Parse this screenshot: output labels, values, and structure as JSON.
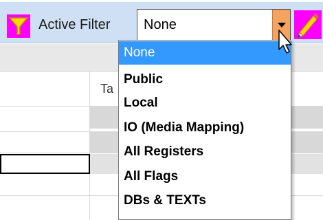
{
  "toolbar": {
    "filter_icon": "filter-funnel-icon",
    "label": "Active Filter",
    "combo_value": "None",
    "combo_arrow_icon": "chevron-down-icon",
    "edit_icon": "pencil-icon",
    "accent_color": "#f4a460",
    "icon_bg_color": "#ff00ff"
  },
  "grid": {
    "column_header": "Ta"
  },
  "dropdown": {
    "options": [
      {
        "label": "None",
        "selected": true
      },
      {
        "label": "Public",
        "selected": false
      },
      {
        "label": "Local",
        "selected": false
      },
      {
        "label": "IO (Media Mapping)",
        "selected": false
      },
      {
        "label": "All Registers",
        "selected": false
      },
      {
        "label": "All Flags",
        "selected": false
      },
      {
        "label": "DBs & TEXTs",
        "selected": false
      }
    ],
    "selected_color": "#3399ff"
  },
  "pointer_icon": "mouse-cursor-icon"
}
